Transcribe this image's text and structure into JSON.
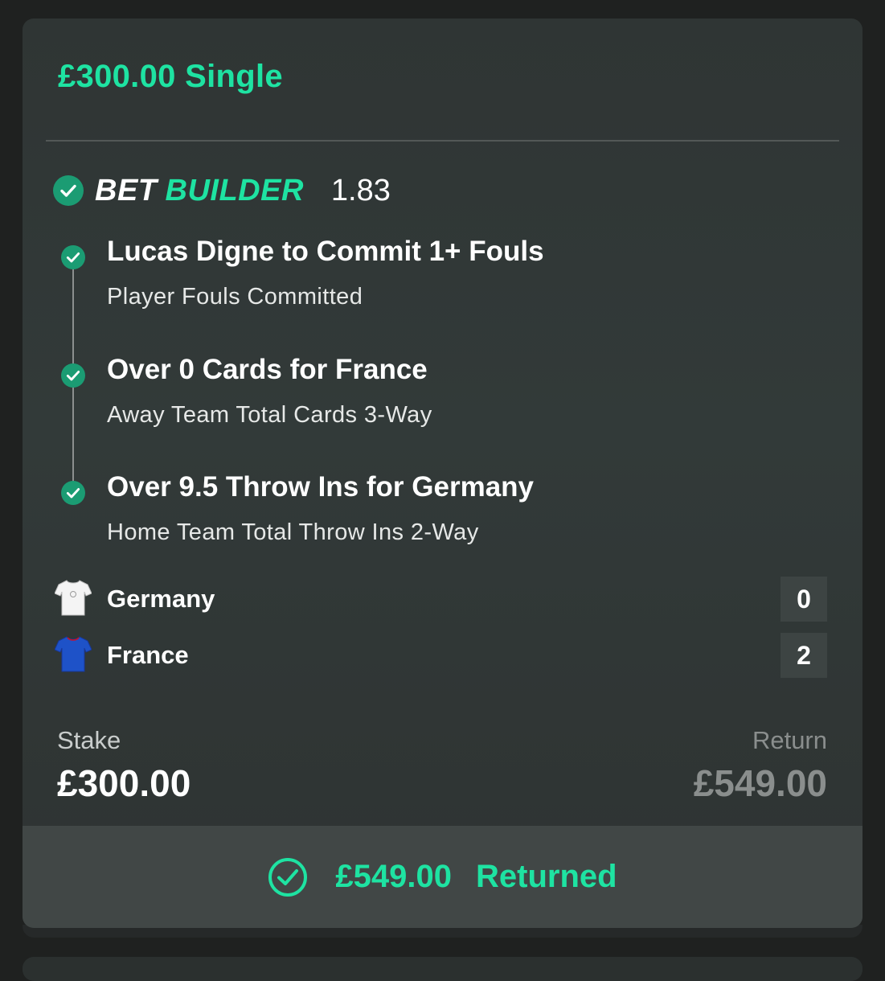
{
  "bet": {
    "title": "£300.00 Single",
    "builder_label_1": "BET",
    "builder_label_2": "BUILDER",
    "odds": "1.83"
  },
  "legs": [
    {
      "title": "Lucas Digne to Commit 1+ Fouls",
      "subtitle": "Player Fouls Committed"
    },
    {
      "title": "Over 0 Cards for France",
      "subtitle": "Away Team Total Cards 3-Way"
    },
    {
      "title": "Over 9.5 Throw Ins for Germany",
      "subtitle": "Home Team Total Throw Ins 2-Way"
    }
  ],
  "teams": [
    {
      "name": "Germany",
      "score": "0",
      "shirt_color": "#ffffff"
    },
    {
      "name": "France",
      "score": "2",
      "shirt_color": "#1e52c8"
    }
  ],
  "stake": {
    "label": "Stake",
    "value": "£300.00"
  },
  "return": {
    "label": "Return",
    "value": "£549.00"
  },
  "footer": {
    "amount": "£549.00",
    "status": "Returned"
  },
  "colors": {
    "accent": "#1ee3a2",
    "check_fill": "#1b9c73",
    "card_bg": "#323a39",
    "footer_bg": "#414746"
  },
  "icons": [
    "check-circle-icon",
    "shirt-icon",
    "check-outline-icon"
  ]
}
